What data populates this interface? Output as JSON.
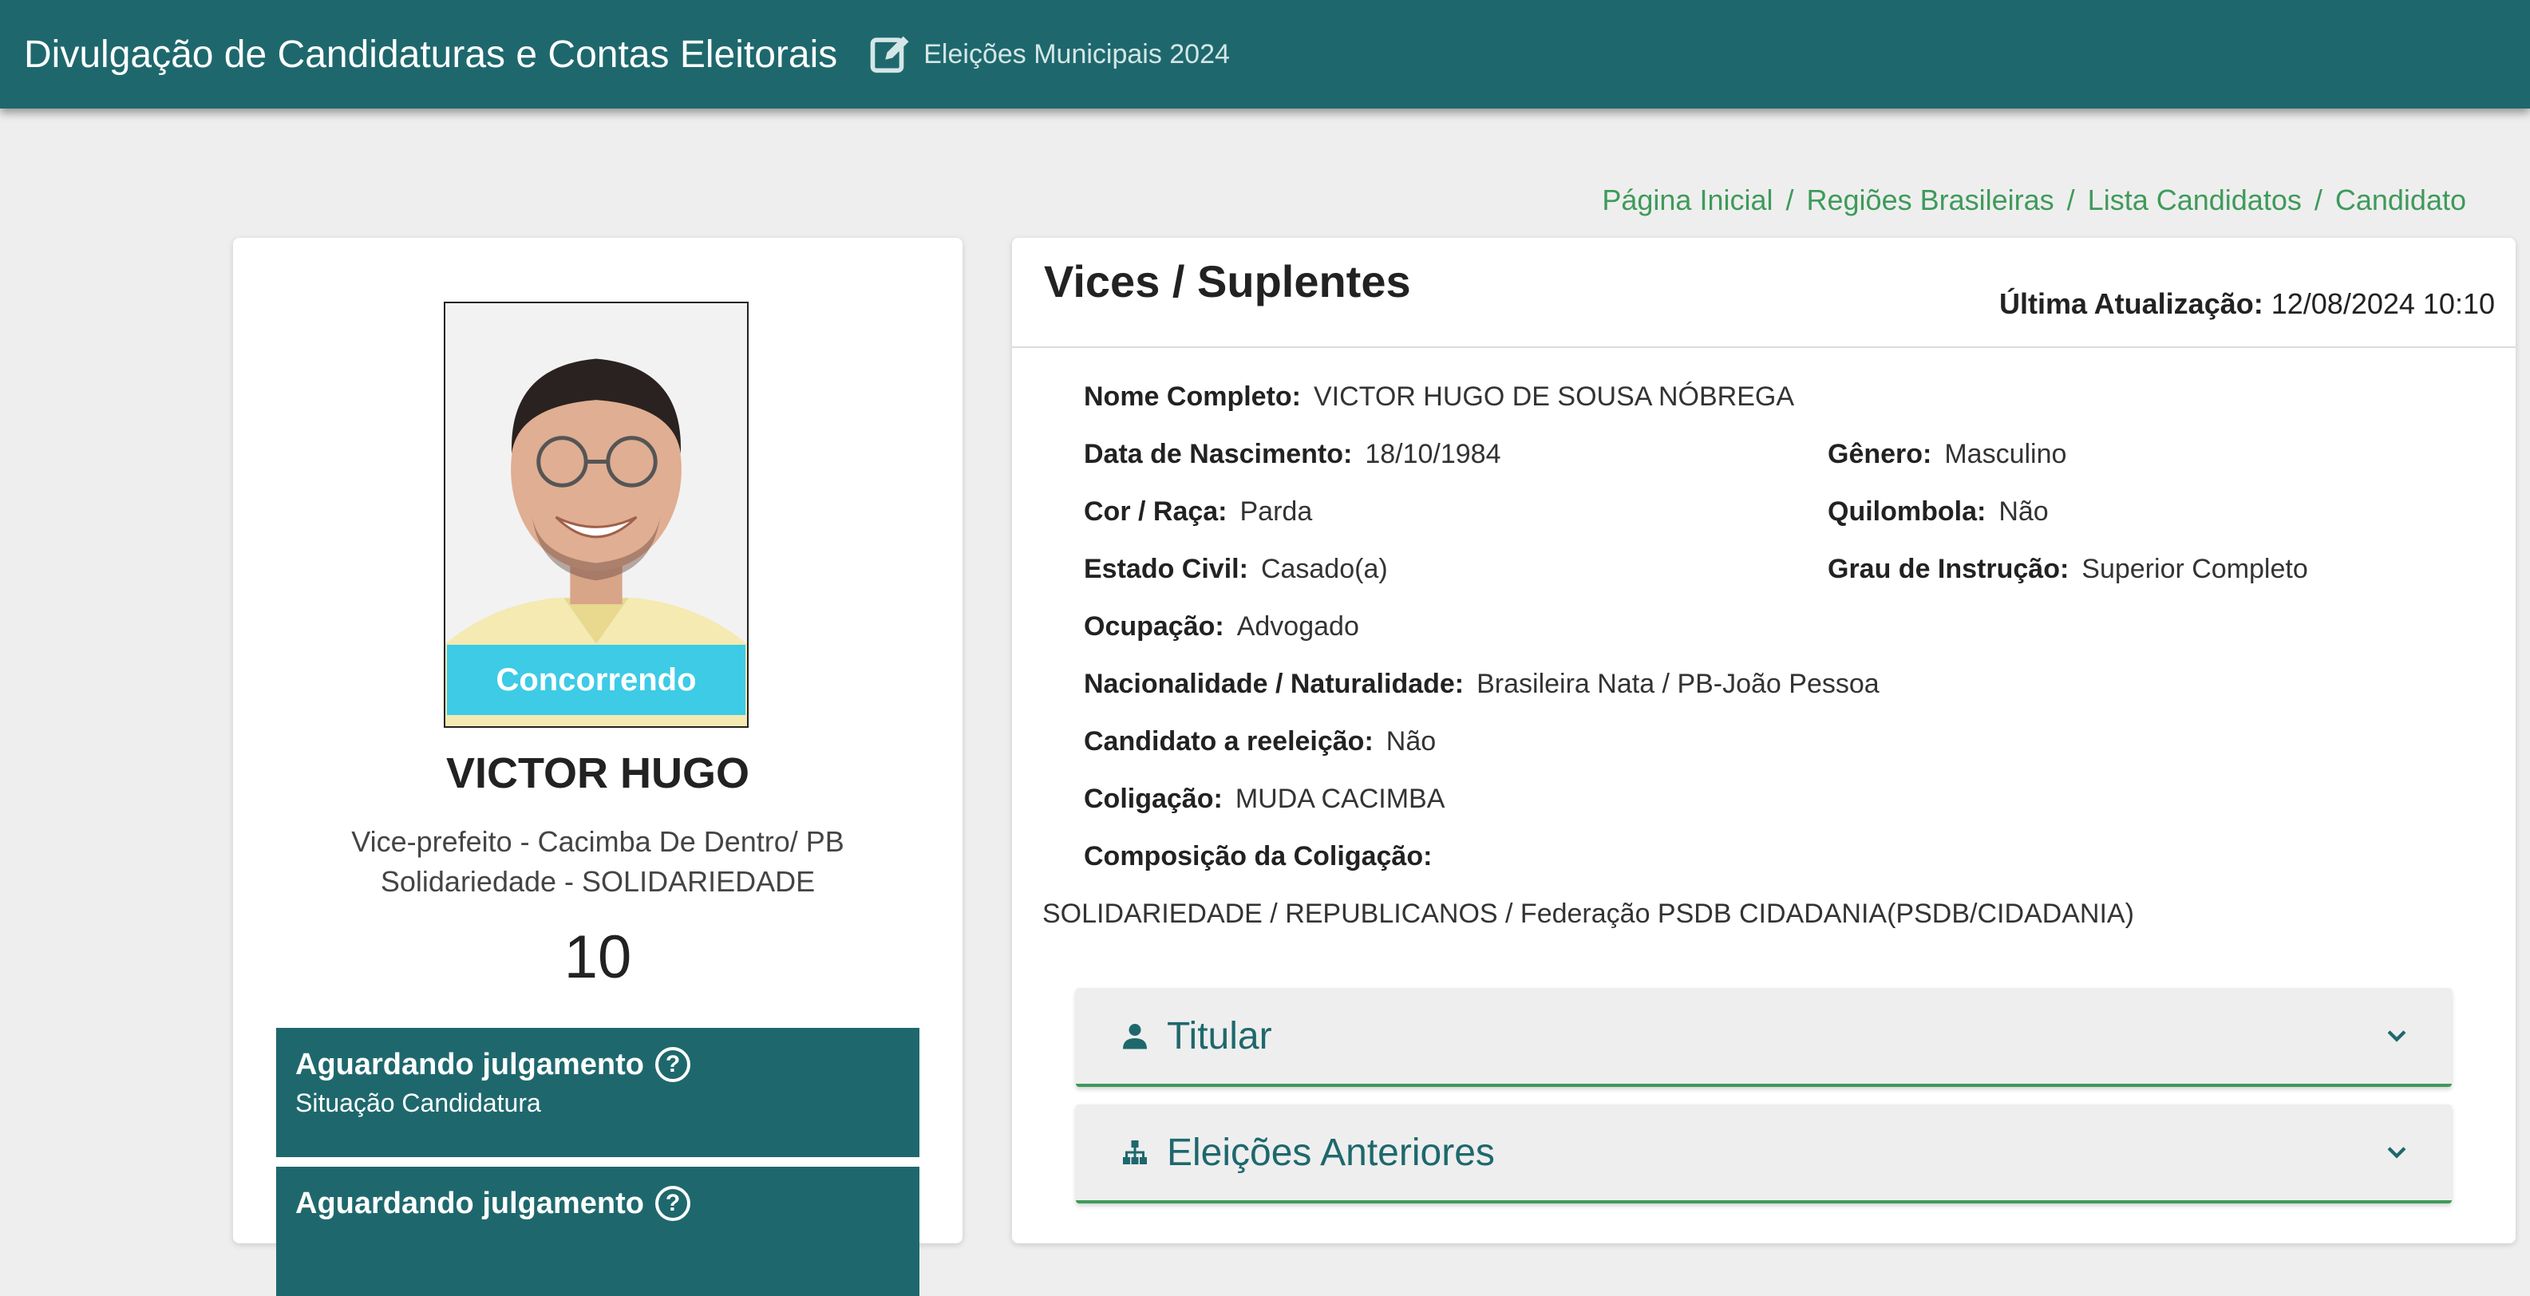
{
  "header": {
    "app_title": "Divulgação de Candidaturas e Contas Eleitorais",
    "election": "Eleições Municipais 2024"
  },
  "breadcrumb": [
    "Página Inicial",
    "Regiões Brasileiras",
    "Lista Candidatos",
    "Candidato"
  ],
  "candidate": {
    "status_badge": "Concorrendo",
    "name": "VICTOR HUGO",
    "role": "Vice-prefeito - Cacimba De Dentro/ PB",
    "party": "Solidariedade - SOLIDARIEDADE",
    "number": "10",
    "status_boxes": [
      {
        "title": "Aguardando julgamento",
        "subtitle": "Situação Candidatura"
      },
      {
        "title": "Aguardando julgamento",
        "subtitle": ""
      }
    ]
  },
  "details": {
    "section_title": "Vices / Suplentes",
    "updated_label": "Última Atualização:",
    "updated_value": "12/08/2024 10:10",
    "fields": {
      "full_name": {
        "label": "Nome Completo:",
        "value": "VICTOR HUGO DE SOUSA NÓBREGA"
      },
      "birth_date": {
        "label": "Data de Nascimento:",
        "value": "18/10/1984"
      },
      "gender": {
        "label": "Gênero:",
        "value": "Masculino"
      },
      "race": {
        "label": "Cor / Raça:",
        "value": "Parda"
      },
      "quilombola": {
        "label": "Quilombola:",
        "value": "Não"
      },
      "marital": {
        "label": "Estado Civil:",
        "value": "Casado(a)"
      },
      "education": {
        "label": "Grau de Instrução:",
        "value": "Superior Completo"
      },
      "occupation": {
        "label": "Ocupação:",
        "value": "Advogado"
      },
      "nationality": {
        "label": "Nacionalidade / Naturalidade:",
        "value": "Brasileira Nata / PB-João Pessoa"
      },
      "reelection": {
        "label": "Candidato a reeleição:",
        "value": "Não"
      },
      "coalition": {
        "label": "Coligação:",
        "value": "MUDA CACIMBA"
      },
      "coalition_comp": {
        "label": "Composição da Coligação:",
        "value": "SOLIDARIEDADE / REPUBLICANOS / Federação PSDB CIDADANIA(PSDB/CIDADANIA)"
      }
    },
    "accordions": [
      {
        "label": "Titular",
        "icon": "person-icon"
      },
      {
        "label": "Eleições Anteriores",
        "icon": "sitemap-icon"
      }
    ]
  }
}
